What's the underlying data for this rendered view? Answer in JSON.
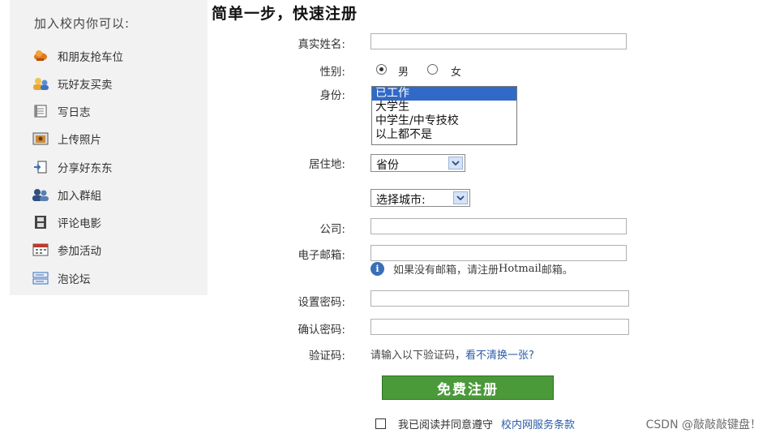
{
  "sidebar": {
    "title": "加入校内你可以:",
    "items": [
      {
        "label": "和朋友抢车位",
        "icon": "car-icon"
      },
      {
        "label": "玩好友买卖",
        "icon": "people-trade-icon"
      },
      {
        "label": "写日志",
        "icon": "notebook-icon"
      },
      {
        "label": "上传照片",
        "icon": "photo-icon"
      },
      {
        "label": "分享好东东",
        "icon": "share-icon"
      },
      {
        "label": "加入群組",
        "icon": "group-icon"
      },
      {
        "label": "评论电影",
        "icon": "film-icon"
      },
      {
        "label": "参加活动",
        "icon": "calendar-icon"
      },
      {
        "label": "泡论坛",
        "icon": "forum-icon"
      }
    ]
  },
  "form": {
    "title": "简单一步，快速注册",
    "labels": {
      "real_name": "真实姓名:",
      "gender": "性别:",
      "identity": "身份:",
      "residence": "居住地:",
      "company": "公司:",
      "email": "电子邮箱:",
      "password": "设置密码:",
      "confirm_password": "确认密码:",
      "captcha": "验证码:"
    },
    "gender": {
      "male": "男",
      "female": "女",
      "selected": "男"
    },
    "identity_options": [
      "已工作",
      "大学生",
      "中学生/中专技校",
      "以上都不是"
    ],
    "identity_selected": "已工作",
    "province_select": "省份",
    "city_select": "选择城市:",
    "email_note_prefix": "如果没有邮箱，请注册",
    "email_note_hotmail": "Hotmail",
    "email_note_suffix": "邮箱。",
    "captcha_prompt": "请输入以下验证码，",
    "captcha_refresh": "看不清换一张?",
    "submit": "免费注册",
    "agree_text": "我已阅读并同意遵守",
    "agree_link": "校内网服务条款"
  },
  "watermark": "CSDN @敲敲敲键盘！",
  "colors": {
    "sidebar_bg": "#f2f2f2",
    "submit_bg": "#4b9a3a",
    "link": "#2a5ca8",
    "selected_option": "#3169c6"
  }
}
